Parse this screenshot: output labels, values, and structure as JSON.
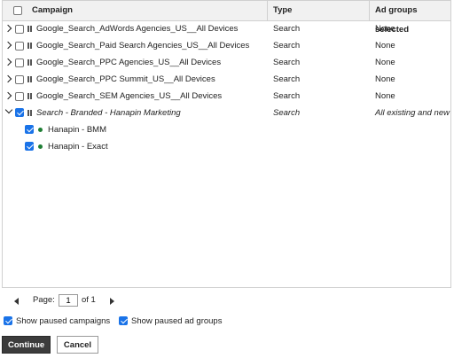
{
  "table": {
    "columns": {
      "campaign": "Campaign",
      "type": "Type",
      "ad_groups": "Ad groups selected"
    },
    "rows": [
      {
        "name": "Google_Search_AdWords Agencies_US__All Devices",
        "type": "Search",
        "ad_groups": "None",
        "checked": false,
        "expanded": false
      },
      {
        "name": "Google_Search_Paid Search Agencies_US__All Devices",
        "type": "Search",
        "ad_groups": "None",
        "checked": false,
        "expanded": false
      },
      {
        "name": "Google_Search_PPC Agencies_US__All Devices",
        "type": "Search",
        "ad_groups": "None",
        "checked": false,
        "expanded": false
      },
      {
        "name": "Google_Search_PPC Summit_US__All Devices",
        "type": "Search",
        "ad_groups": "None",
        "checked": false,
        "expanded": false
      },
      {
        "name": "Google_Search_SEM Agencies_US__All Devices",
        "type": "Search",
        "ad_groups": "None",
        "checked": false,
        "expanded": false
      },
      {
        "name": "Search - Branded - Hanapin Marketing",
        "type": "Search",
        "ad_groups": "All existing and new",
        "checked": true,
        "expanded": true
      }
    ],
    "ad_groups": [
      {
        "name": "Hanapin - BMM",
        "checked": true
      },
      {
        "name": "Hanapin - Exact",
        "checked": true
      }
    ]
  },
  "pager": {
    "label": "Page:",
    "current": "1",
    "of_text": "of 1"
  },
  "options": {
    "show_paused_campaigns": "Show paused campaigns",
    "show_paused_ad_groups": "Show paused ad groups"
  },
  "buttons": {
    "continue": "Continue",
    "cancel": "Cancel"
  },
  "colors": {
    "checkbox_checked": "#1a73e8",
    "enabled_dot": "#1e7e34",
    "primary_button": "#3c3c3c"
  }
}
